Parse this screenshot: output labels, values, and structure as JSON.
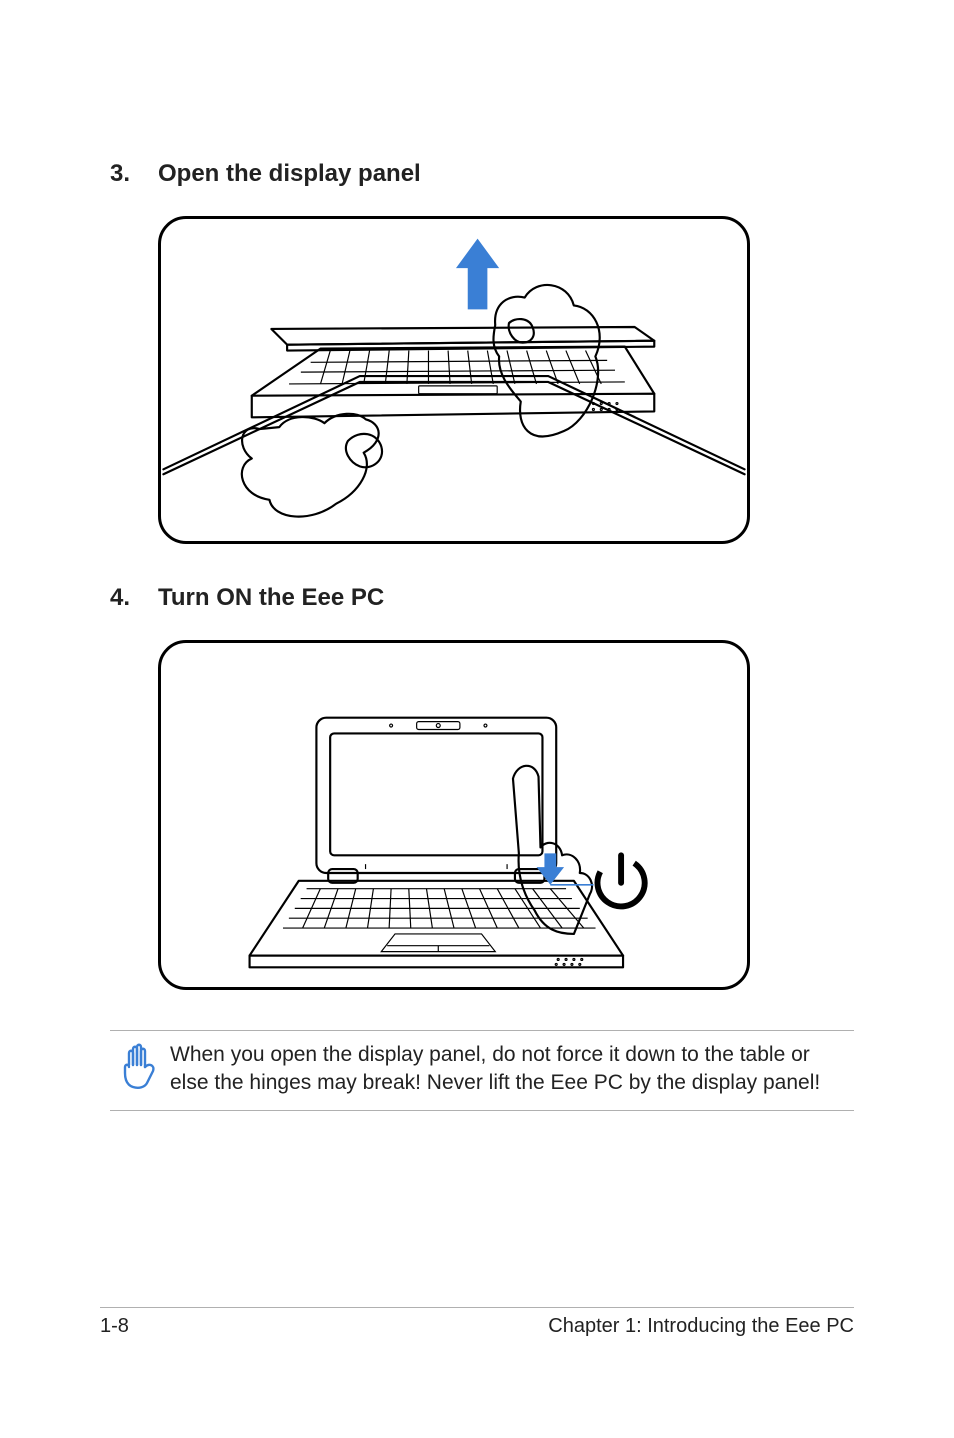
{
  "steps": [
    {
      "num": "3.",
      "title": "Open the display panel"
    },
    {
      "num": "4.",
      "title": "Turn ON the Eee PC"
    }
  ],
  "caution": {
    "text": "When you open the display panel, do not force it down to the table or else the hinges may break! Never lift the Eee PC by the display panel!"
  },
  "footer": {
    "page": "1-8",
    "chapter": "Chapter 1: Introducing the Eee PC"
  },
  "colors": {
    "accent_blue": "#3a7fd5"
  }
}
